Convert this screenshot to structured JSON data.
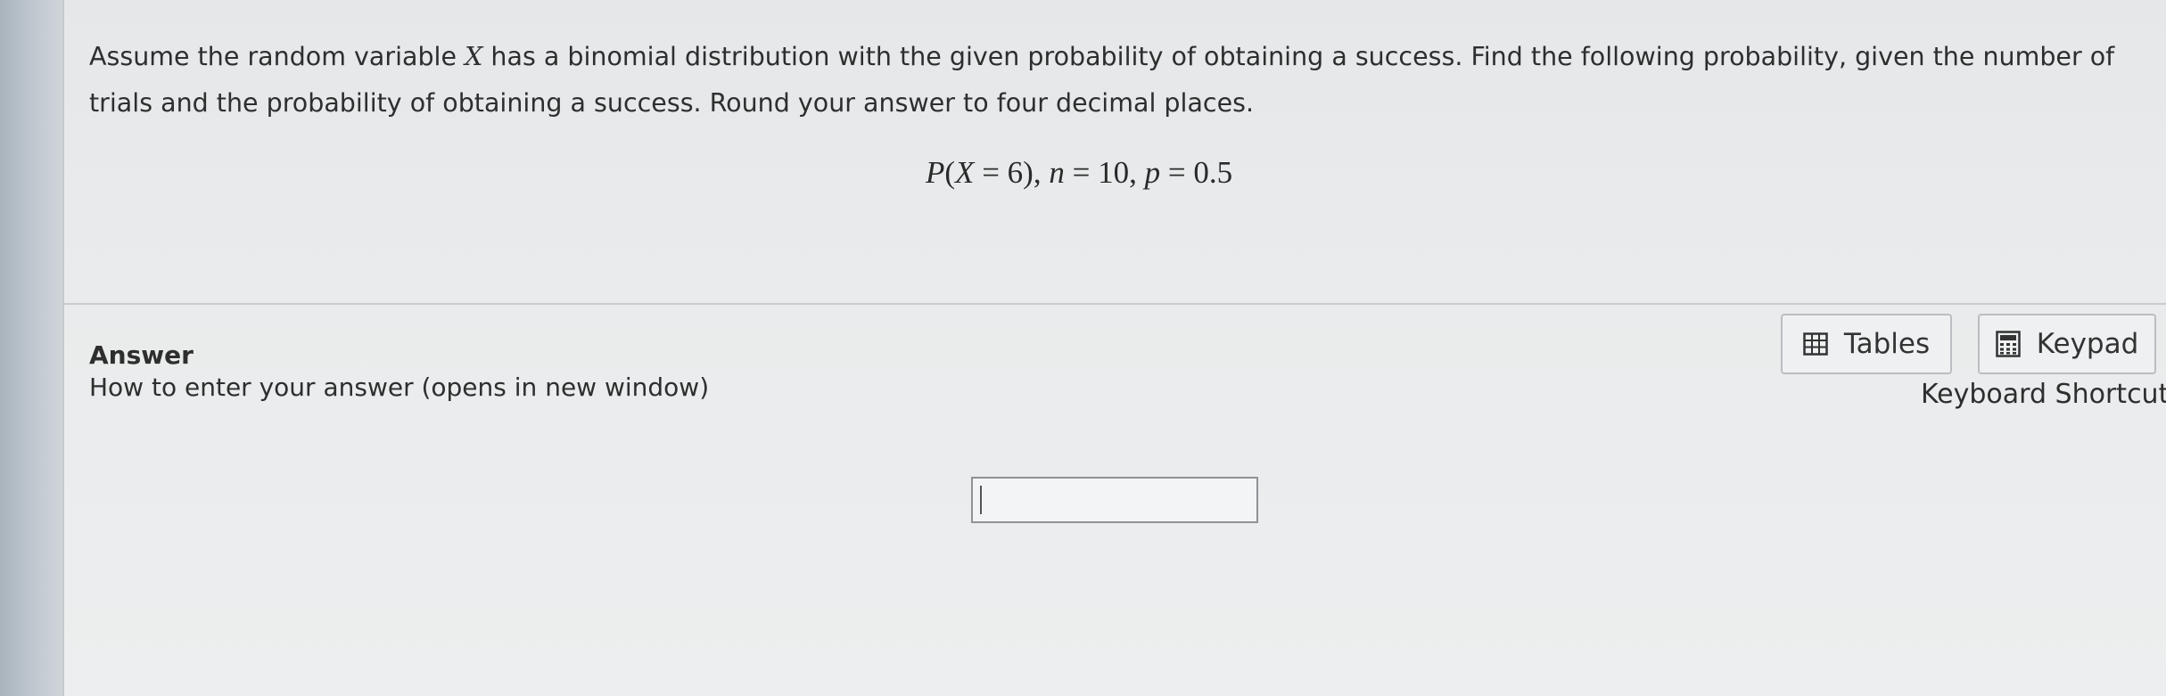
{
  "question": {
    "text_before_var": "Assume the random variable ",
    "variable": "X",
    "text_after_var": " has a binomial distribution with the given probability of obtaining a success. Find the following probability, given the number of trials and the probability of obtaining a success. Round your answer to four decimal places.",
    "formula": {
      "lead": "P",
      "open": "(",
      "var": "X",
      "eq1": " = 6), ",
      "n_var": "n",
      "eq2": " = 10, ",
      "p_var": "p",
      "eq3": " = 0.5"
    }
  },
  "answer": {
    "label": "Answer",
    "howto_link": "How to enter your answer (opens in new window)",
    "input_value": ""
  },
  "toolbar": {
    "tables_label": "Tables",
    "tables_icon": "table-icon",
    "keypad_label": "Keypad",
    "keypad_icon": "calculator-icon",
    "shortcuts_label": "Keyboard Shortcuts"
  }
}
